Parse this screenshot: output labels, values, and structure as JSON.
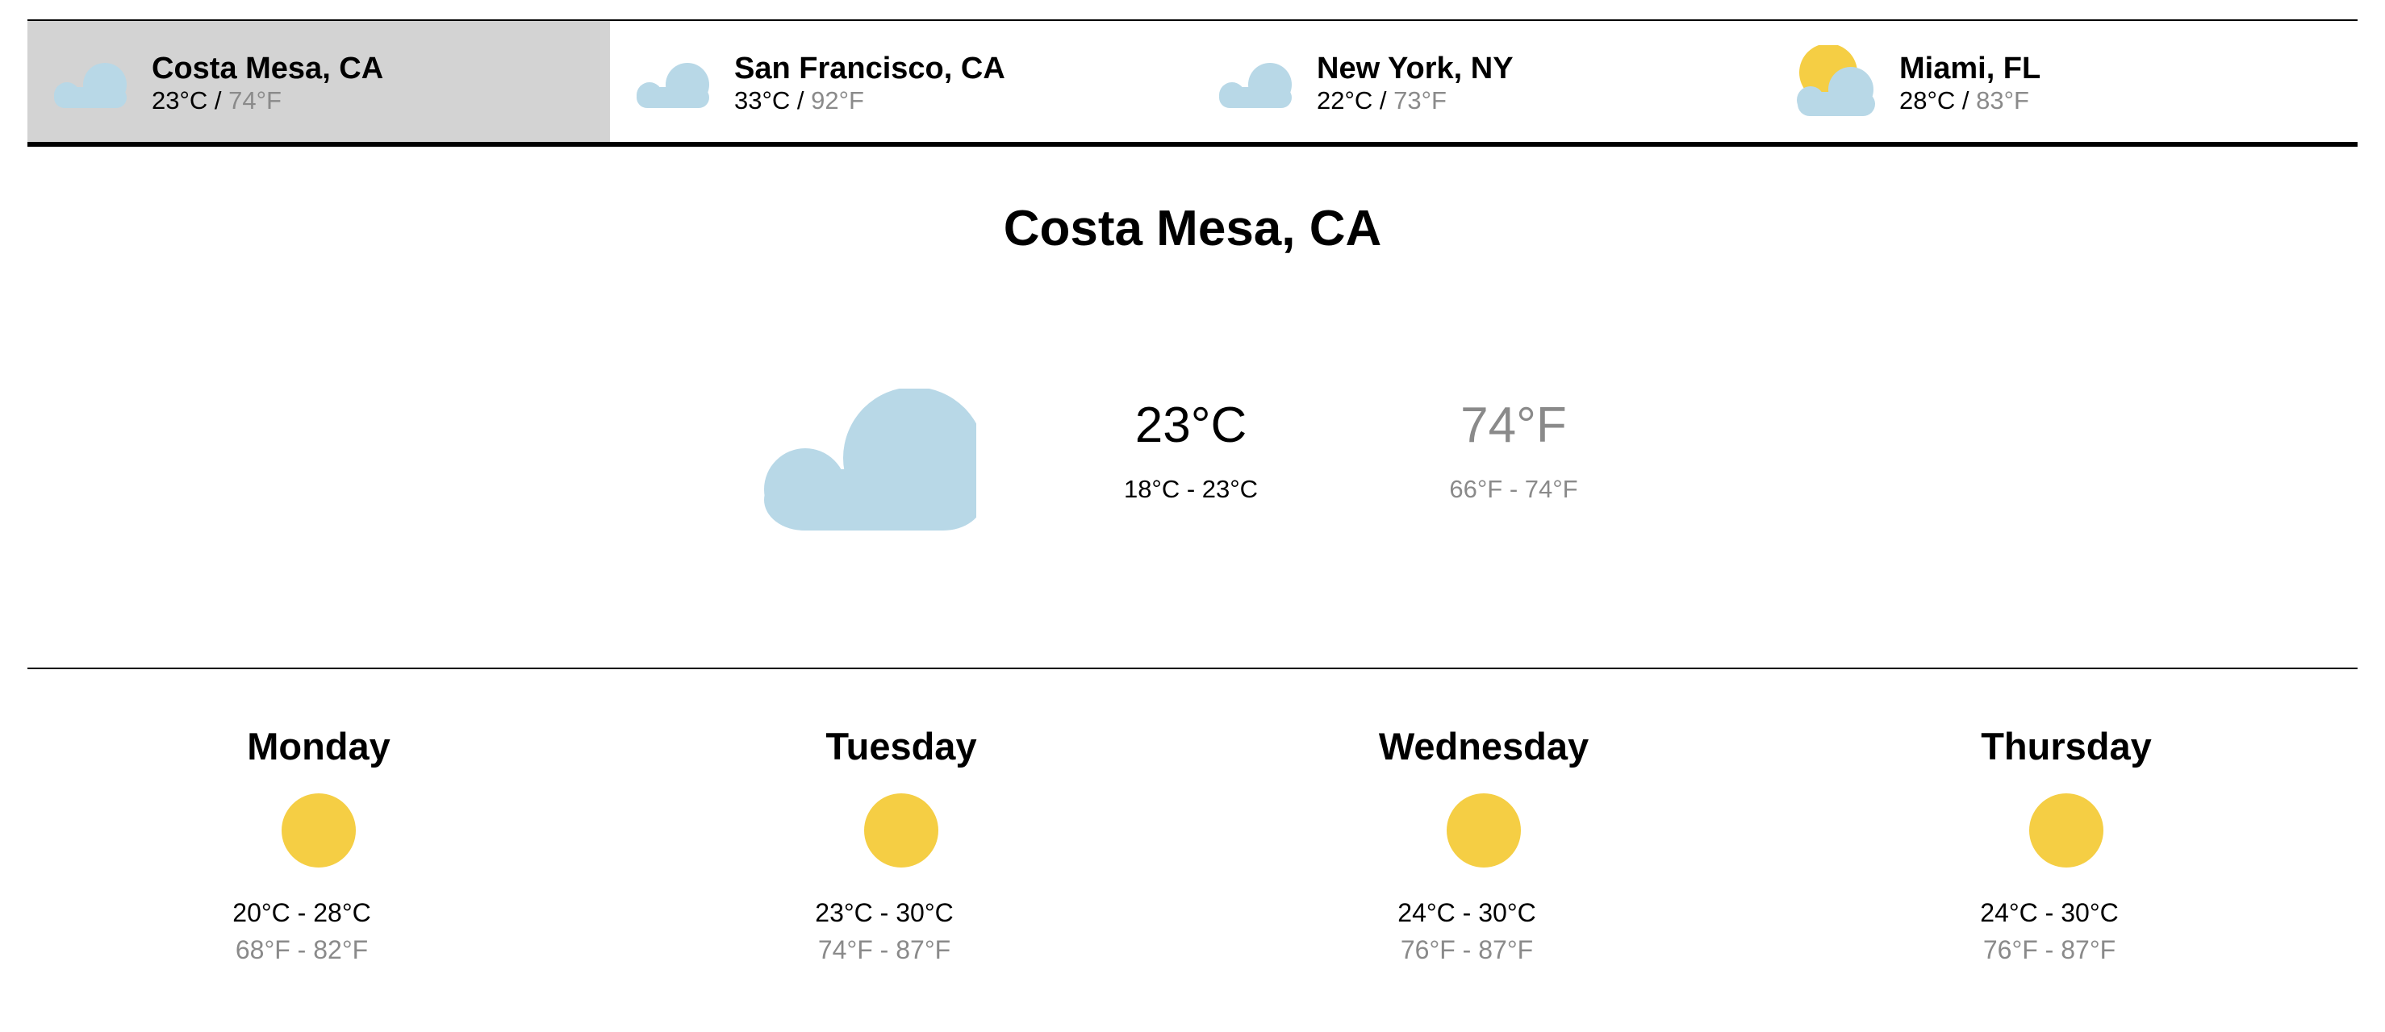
{
  "colors": {
    "selected_tab_bg": "#d3d3d3",
    "cloud": "#b8d8e7",
    "sun": "#f5ce44",
    "fahrenheit_text": "#8a8a8a"
  },
  "cities": [
    {
      "name": "Costa Mesa, CA",
      "celsius": "23°C",
      "separator": " / ",
      "fahrenheit": "74°F",
      "icon": "cloud-icon",
      "selected": true
    },
    {
      "name": "San Francisco, CA",
      "celsius": "33°C",
      "separator": " / ",
      "fahrenheit": "92°F",
      "icon": "cloud-icon",
      "selected": false
    },
    {
      "name": "New York, NY",
      "celsius": "22°C",
      "separator": " / ",
      "fahrenheit": "73°F",
      "icon": "cloud-icon",
      "selected": false
    },
    {
      "name": "Miami, FL",
      "celsius": "28°C",
      "separator": " / ",
      "fahrenheit": "83°F",
      "icon": "partly-cloudy-icon",
      "selected": false
    }
  ],
  "current": {
    "city": "Costa Mesa, CA",
    "icon": "cloud-icon",
    "celsius": "23°C",
    "celsius_range": "18°C - 23°C",
    "fahrenheit": "74°F",
    "fahrenheit_range": "66°F - 74°F"
  },
  "forecast": [
    {
      "day": "Monday",
      "icon": "sun-icon",
      "celsius_range": "20°C - 28°C",
      "fahrenheit_range": "68°F - 82°F"
    },
    {
      "day": "Tuesday",
      "icon": "sun-icon",
      "celsius_range": "23°C - 30°C",
      "fahrenheit_range": "74°F - 87°F"
    },
    {
      "day": "Wednesday",
      "icon": "sun-icon",
      "celsius_range": "24°C - 30°C",
      "fahrenheit_range": "76°F - 87°F"
    },
    {
      "day": "Thursday",
      "icon": "sun-icon",
      "celsius_range": "24°C - 30°C",
      "fahrenheit_range": "76°F - 87°F"
    }
  ]
}
